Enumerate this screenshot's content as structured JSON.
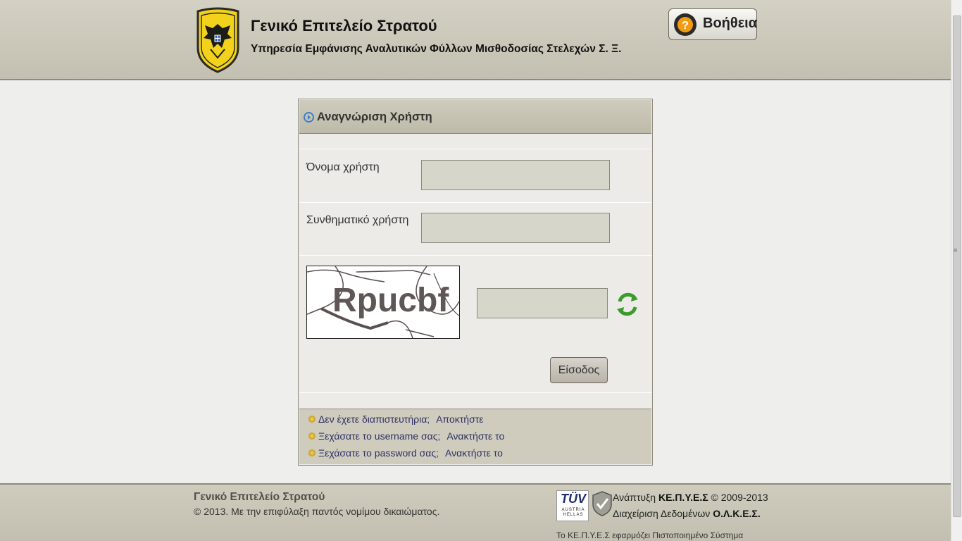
{
  "header": {
    "title": "Γενικό Επιτελείο Στρατού",
    "subtitle": "Υπηρεσία Εμφάνισης Αναλυτικών Φύλλων Μισθοδοσίας Στελεχών Σ. Ξ.",
    "emblem_text": "ΕΛΛΗΝΙΚΟΣ ΣΤΡΑΤΟΣ",
    "help_label": "Βοήθεια"
  },
  "login": {
    "title": "Αναγνώριση Χρήστη",
    "username_label": "Όνομα χρήστη",
    "username_value": "",
    "password_label": "Συνθηματικό χρήστη",
    "password_value": "",
    "captcha_text": "Rpucbf",
    "captcha_value": "",
    "submit_label": "Είσοδος"
  },
  "links": [
    {
      "question": "Δεν έχετε διαπιστευτήρια;",
      "action": "Αποκτήστε"
    },
    {
      "question": "Ξεχάσατε το username σας;",
      "action": "Ανακτήστε το"
    },
    {
      "question": "Ξεχάσατε το password σας;",
      "action": "Ανακτήστε το"
    }
  ],
  "footer": {
    "org": "Γενικό Επιτελείο Στρατού",
    "copyright": "© 2013. Με την επιφύλαξη παντός νομίμου δικαιώματος.",
    "tuv_mark": "TÜV",
    "tuv_sub": "AUSTRIA HELLAS",
    "dev_prefix": "Ανάπτυξη",
    "dev_org": "ΚΕ.Π.Υ.Ε.Σ",
    "dev_suffix": "© 2009-2013",
    "data_prefix": "Διαχείριση Δεδομένων",
    "data_org": "Ο.Λ.Κ.Ε.Σ.",
    "cert": "Το ΚΕ.Π.Υ.Ε.Σ εφαρμόζει Πιστοποιημένο Σύστημα"
  },
  "colors": {
    "header_bg": "#c8c5b7",
    "panel_head_bg": "#c6c3b3",
    "field_bg": "#d7d6cb",
    "link_text": "#2d3166",
    "emblem_yellow": "#f2d21b"
  }
}
